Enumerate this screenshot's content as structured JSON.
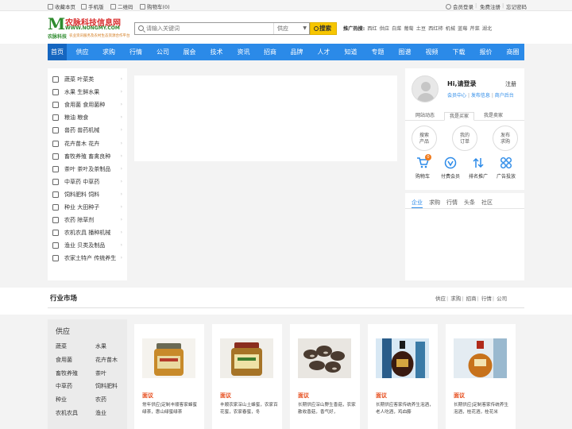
{
  "topbar": {
    "left": [
      "收藏本页",
      "手机版",
      "二维码",
      "购物车(0)"
    ],
    "right": [
      "会员登录",
      "免费注册",
      "忘记密码"
    ]
  },
  "logo": {
    "name": "农脉科技信息网",
    "url": "WWW.NONGMY.COM",
    "slogan_short": "农脉科技",
    "slogan_long": "农业资讯服务及农村生态资源合作平台"
  },
  "search": {
    "placeholder": "请输入关键词",
    "scope": "供应",
    "button": "搜索"
  },
  "hot": {
    "label": "推广热搜:",
    "items": [
      "西红",
      "供应",
      "白菜",
      "葡萄",
      "土豆",
      "西红柿",
      "机械",
      "蓝莓",
      "芹菜",
      "湖北"
    ]
  },
  "nav": [
    "首页",
    "供应",
    "求购",
    "行情",
    "公司",
    "展会",
    "技术",
    "资讯",
    "招商",
    "品牌",
    "人才",
    "知道",
    "专题",
    "图谱",
    "视频",
    "下载",
    "报价",
    "商圈"
  ],
  "categories": [
    {
      "a": "蔬菜",
      "b": "叶菜类"
    },
    {
      "a": "水果",
      "b": "生鲜水果"
    },
    {
      "a": "食用菌",
      "b": "食用菌种"
    },
    {
      "a": "粮油",
      "b": "粮食"
    },
    {
      "a": "兽药",
      "b": "兽药机械"
    },
    {
      "a": "花卉苗木",
      "b": "花卉"
    },
    {
      "a": "畜牧养殖",
      "b": "畜禽良种"
    },
    {
      "a": "茶叶",
      "b": "茶叶及茶制品"
    },
    {
      "a": "中草药",
      "b": "中草药"
    },
    {
      "a": "饲料肥料",
      "b": "饲料"
    },
    {
      "a": "种业",
      "b": "大田种子"
    },
    {
      "a": "农药",
      "b": "除草剂"
    },
    {
      "a": "农机农具",
      "b": "播种机械"
    },
    {
      "a": "渔业",
      "b": "贝类及制品"
    },
    {
      "a": "农家土特产",
      "b": "传统养生"
    }
  ],
  "user": {
    "greeting": "Hi,请登录",
    "register": "注册",
    "links": [
      "会员中心",
      "发布信息",
      "商户后台"
    ],
    "tabs": [
      "网站动态",
      "我是买家",
      "我是卖家"
    ],
    "circles": [
      [
        "搜索",
        "产品"
      ],
      [
        "我的",
        "订单"
      ],
      [
        "发布",
        "求购"
      ]
    ],
    "quick": [
      "购物车",
      "付费会员",
      "排名推广",
      "广告投放"
    ],
    "cart_count": "0"
  },
  "news": {
    "tabs": [
      "企业",
      "求购",
      "行情",
      "头条",
      "社区"
    ]
  },
  "market": {
    "title": "行业市场",
    "links": [
      "供应",
      "求购",
      "招商",
      "行情",
      "公司"
    ],
    "supply_title": "供应",
    "supply_items": [
      "蔬菜",
      "水果",
      "食用菌",
      "花卉苗木",
      "畜牧养殖",
      "茶叶",
      "中草药",
      "饲料肥料",
      "种业",
      "农药",
      "农机农具",
      "渔业"
    ],
    "cards": [
      {
        "tag": "面议",
        "desc": "常年供应|定制丰顺客家蜂蜜绿茶，惠山绿蜜绿茶"
      },
      {
        "tag": "面议",
        "desc": "丰顺农家深山土蜂蜜，农家百花蜜，农家春蜜，冬"
      },
      {
        "tag": "面议",
        "desc": "长期供应深山野生香菇，农家散收香菇，香气好，"
      },
      {
        "tag": "面议",
        "desc": "长期供应客家传统养生泡酒，老人吃酒，鸡血藤"
      },
      {
        "tag": "面议",
        "desc": "长期供应|定制客家传统养生泡酒，桂花酒，桂花米"
      }
    ]
  }
}
